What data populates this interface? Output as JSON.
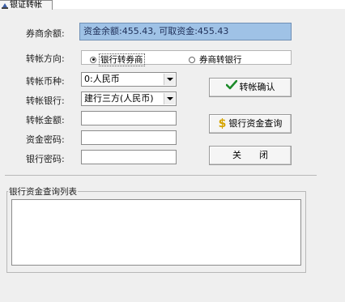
{
  "tab": {
    "label": "银证转帐"
  },
  "labels": {
    "balance": "券商余额:",
    "direction": "转帐方向:",
    "currency": "转帐币种:",
    "bank": "转帐银行:",
    "amount": "转帐金额:",
    "fund_password": "资金密码:",
    "bank_password": "银行密码:"
  },
  "balance_info": "资金余额:455.43, 可取资金:455.43",
  "direction": {
    "options": [
      {
        "label": "银行转券商",
        "selected": true
      },
      {
        "label": "券商转银行",
        "selected": false
      }
    ]
  },
  "currency_select": {
    "value": "0:人民币"
  },
  "bank_select": {
    "value": "建行三方(人民币)"
  },
  "inputs": {
    "amount": "",
    "fund_password": "",
    "bank_password": ""
  },
  "buttons": {
    "confirm": "转帐确认",
    "query": "银行资金查询",
    "close": "关　　闭"
  },
  "list_group": {
    "title": "银行资金查询列表"
  },
  "icons": {
    "tab": "transfer-icon",
    "confirm": "checkmark-icon",
    "query": "dollar-icon"
  },
  "colors": {
    "info_bg": "#9fc2e6",
    "info_text": "#1f2f58",
    "check_green": "#1c8a2a",
    "dollar_gold": "#d6a500",
    "panel_bg": "#efefef"
  }
}
